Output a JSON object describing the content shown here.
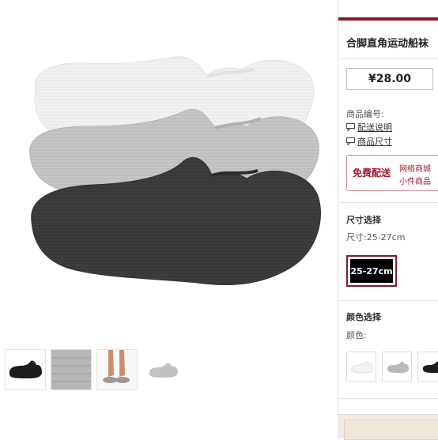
{
  "product": {
    "title": "合脚直角运动船袜",
    "price": "¥28.00",
    "code_label": "商品编号:",
    "delivery_link": "配送说明",
    "size_link": "商品尺寸"
  },
  "shipping": {
    "badge": "免费配送",
    "line1": "网络商城",
    "line2": "小件商品"
  },
  "size_section": {
    "title": "尺寸选择",
    "current": "尺寸:25-27cm",
    "options": [
      "25-27cm"
    ],
    "selected": "25-27cm"
  },
  "color_section": {
    "title": "颜色选择",
    "current": "颜色:",
    "swatches": [
      "white",
      "gray",
      "black"
    ]
  },
  "thumbnails": [
    "black-sock",
    "gray-fabric",
    "worn-on-feet",
    "gray-sock"
  ],
  "colors": {
    "accent": "#7a1f2b",
    "sock_white": "#f1f1f0",
    "sock_gray": "#c4c4c4",
    "sock_dark": "#3b3b3b"
  }
}
